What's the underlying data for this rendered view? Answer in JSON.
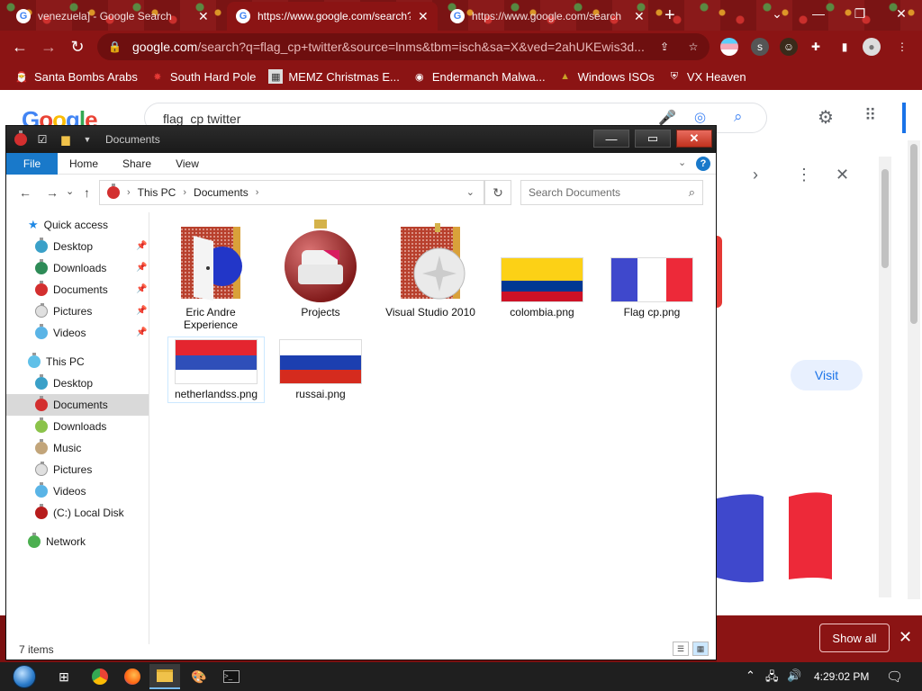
{
  "browser": {
    "tabs": [
      {
        "title": "venezuela] - Google Search",
        "active": false
      },
      {
        "title": "https://www.google.com/search?",
        "active": true
      },
      {
        "title": "https://www.google.com/search",
        "active": false
      }
    ],
    "url_host": "google.com",
    "url_path": "/search?q=flag_cp+twitter&source=lnms&tbm=isch&sa=X&ved=2ahUKEwis3d...",
    "bookmarks": [
      {
        "label": "Santa Bombs Arabs",
        "icon": "santa-icon"
      },
      {
        "label": "South Hard Pole",
        "icon": "star-icon"
      },
      {
        "label": "MEMZ Christmas E...",
        "icon": "image-icon"
      },
      {
        "label": "Endermanch Malwa...",
        "icon": "panda-icon"
      },
      {
        "label": "Windows ISOs",
        "icon": "tree-icon"
      },
      {
        "label": "VX Heaven",
        "icon": "shield-icon"
      }
    ],
    "search_query": "flag_cp twitter",
    "visit_label": "Visit",
    "show_all_label": "Show all"
  },
  "explorer": {
    "window_title": "Documents",
    "ribbon_tabs": [
      "File",
      "Home",
      "Share",
      "View"
    ],
    "breadcrumb": [
      "This PC",
      "Documents"
    ],
    "search_placeholder": "Search Documents",
    "nav": {
      "quick_access": "Quick access",
      "quick_items": [
        "Desktop",
        "Downloads",
        "Documents",
        "Pictures",
        "Videos"
      ],
      "this_pc": "This PC",
      "pc_items": [
        "Desktop",
        "Documents",
        "Downloads",
        "Music",
        "Pictures",
        "Videos",
        "(C:) Local Disk"
      ],
      "network": "Network",
      "selected": "Documents"
    },
    "items": [
      {
        "name": "Eric Andre Experience",
        "type": "folder"
      },
      {
        "name": "Projects",
        "type": "folder"
      },
      {
        "name": "Visual Studio 2010",
        "type": "folder"
      },
      {
        "name": "colombia.png",
        "type": "image"
      },
      {
        "name": "Flag cp.png",
        "type": "image"
      },
      {
        "name": "netherlandss.png",
        "type": "image"
      },
      {
        "name": "russai.png",
        "type": "image"
      }
    ],
    "status_count": "7 items"
  },
  "taskbar": {
    "clock": "4:29:02 PM"
  },
  "colors": {
    "browser_theme": "#8b1414",
    "explorer_file_tab": "#1979ca",
    "colombia": [
      "#fcd116",
      "#003893",
      "#ce1126"
    ],
    "france": [
      "#3f48cc",
      "#ffffff",
      "#ed2939"
    ],
    "serbia_like": [
      "#e4252f",
      "#2f4fb9",
      "#ffffff"
    ],
    "russia": [
      "#ffffff",
      "#1c3fb0",
      "#d52b1e"
    ]
  }
}
